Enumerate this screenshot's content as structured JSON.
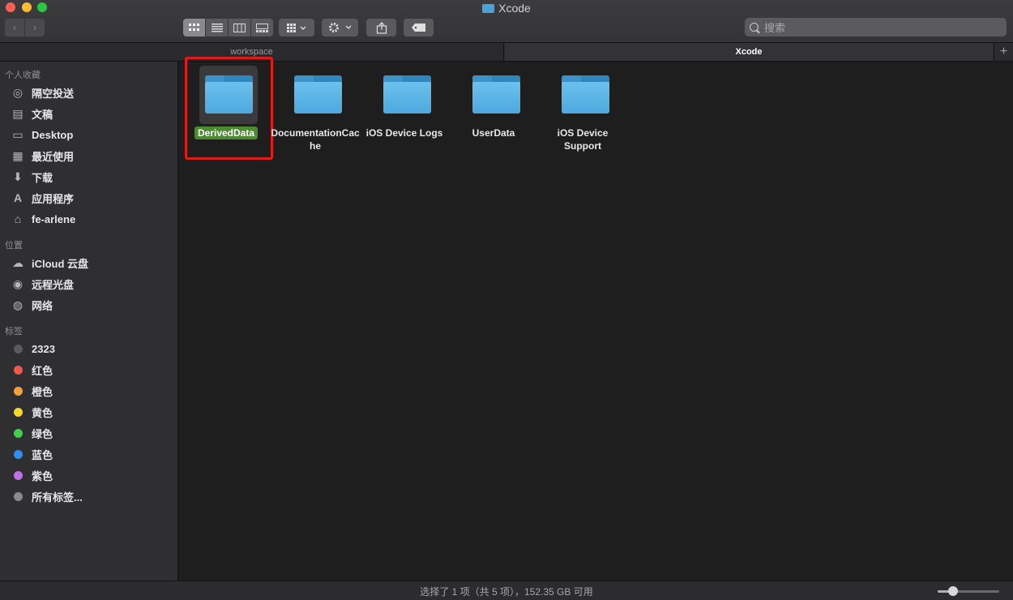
{
  "window": {
    "title": "Xcode"
  },
  "toolbar": {
    "back_glyph": "‹",
    "forward_glyph": "›",
    "view_modes": [
      "icon",
      "list",
      "column",
      "gallery"
    ],
    "group_icon": "grid-icon",
    "action_icon": "gear-icon",
    "share_icon": "share-icon",
    "tag_icon": "tag-icon",
    "search_placeholder": "搜索"
  },
  "tabs": [
    {
      "label": "workspace",
      "active": false
    },
    {
      "label": "Xcode",
      "active": true
    }
  ],
  "tab_add": "+",
  "sidebar": {
    "favorites_header": "个人收藏",
    "favorites": [
      {
        "label": "隔空投送",
        "icon": "airdrop-icon",
        "glyph": "◎"
      },
      {
        "label": "文稿",
        "icon": "document-icon",
        "glyph": "▤"
      },
      {
        "label": "Desktop",
        "icon": "desktop-icon",
        "glyph": "▭"
      },
      {
        "label": "最近使用",
        "icon": "recents-icon",
        "glyph": "▦"
      },
      {
        "label": "下载",
        "icon": "download-icon",
        "glyph": "⬇"
      },
      {
        "label": "应用程序",
        "icon": "applications-icon",
        "glyph": "A"
      },
      {
        "label": "fe-arlene",
        "icon": "home-icon",
        "glyph": "⌂"
      }
    ],
    "locations_header": "位置",
    "locations": [
      {
        "label": "iCloud 云盘",
        "icon": "cloud-icon",
        "glyph": "☁"
      },
      {
        "label": "远程光盘",
        "icon": "disc-icon",
        "glyph": "◉"
      },
      {
        "label": "网络",
        "icon": "network-icon",
        "glyph": "◍"
      }
    ],
    "tags_header": "标签",
    "tags": [
      {
        "label": "2323",
        "color": "#5a5a5c"
      },
      {
        "label": "红色",
        "color": "#f2564d"
      },
      {
        "label": "橙色",
        "color": "#f7a233"
      },
      {
        "label": "黄色",
        "color": "#f8d62a"
      },
      {
        "label": "绿色",
        "color": "#3fcf49"
      },
      {
        "label": "蓝色",
        "color": "#2f8ef5"
      },
      {
        "label": "紫色",
        "color": "#c36ee6"
      },
      {
        "label": "所有标签...",
        "color": "#8a8a8c"
      }
    ]
  },
  "files": [
    {
      "name": "DerivedData",
      "selected": true
    },
    {
      "name": "DocumentationCache",
      "selected": false
    },
    {
      "name": "iOS Device Logs",
      "selected": false
    },
    {
      "name": "UserData",
      "selected": false
    },
    {
      "name": "iOS DeviceSupport",
      "selected": false
    }
  ],
  "status": {
    "text": "选择了 1 项（共 5 项），152.35 GB 可用"
  },
  "icon_size_slider": {
    "value": 0.25
  },
  "colors": {
    "folder": "#5ab4e6",
    "selection_label": "#4b8a2f",
    "annotation": "#e01b1b"
  }
}
